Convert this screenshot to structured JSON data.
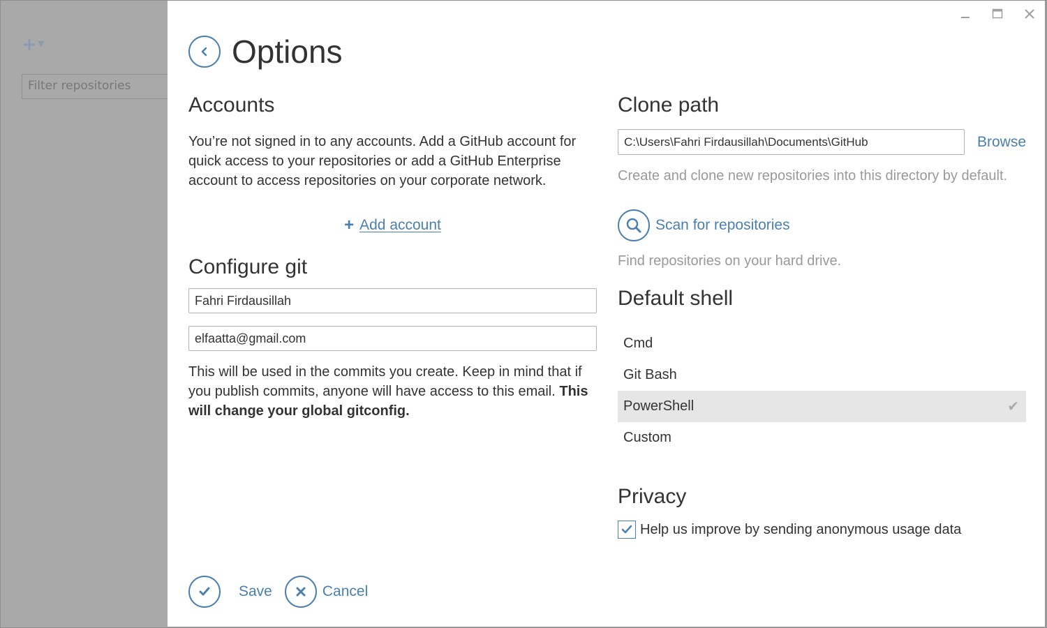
{
  "background_app": {
    "add_button": "+",
    "filter_placeholder": "Filter repositories"
  },
  "window": {
    "controls": [
      "minimize",
      "maximize",
      "close"
    ]
  },
  "header": {
    "title": "Options"
  },
  "accounts": {
    "heading": "Accounts",
    "description": "You’re not signed in to any accounts. Add a GitHub account for quick access to your repositories or add a GitHub Enterprise account to access repositories on your corporate network.",
    "add_account_label": "Add account"
  },
  "configure_git": {
    "heading": "Configure git",
    "name_value": "Fahri Firdausillah",
    "email_value": "elfaatta@gmail.com",
    "note": "This will be used in the commits you create. Keep in mind that if you publish commits, anyone will have access to this email.",
    "note_bold": "This will change your global gitconfig."
  },
  "clone_path": {
    "heading": "Clone path",
    "path_value": "C:\\Users\\Fahri Firdausillah\\Documents\\GitHub",
    "browse_label": "Browse",
    "description": "Create and clone new repositories into this directory by default.",
    "scan_label": "Scan for repositories",
    "scan_description": "Find repositories on your hard drive."
  },
  "default_shell": {
    "heading": "Default shell",
    "options": [
      "Cmd",
      "Git Bash",
      "PowerShell",
      "Custom"
    ],
    "selected": "PowerShell"
  },
  "privacy": {
    "heading": "Privacy",
    "usage_label": "Help us improve by sending anonymous usage data",
    "usage_checked": true
  },
  "footer": {
    "save_label": "Save",
    "cancel_label": "Cancel"
  },
  "colors": {
    "accent": "#4a7fb0",
    "muted_text": "#999999",
    "selected_row": "#e6e6e6",
    "overlay": "#a9a9a9"
  }
}
